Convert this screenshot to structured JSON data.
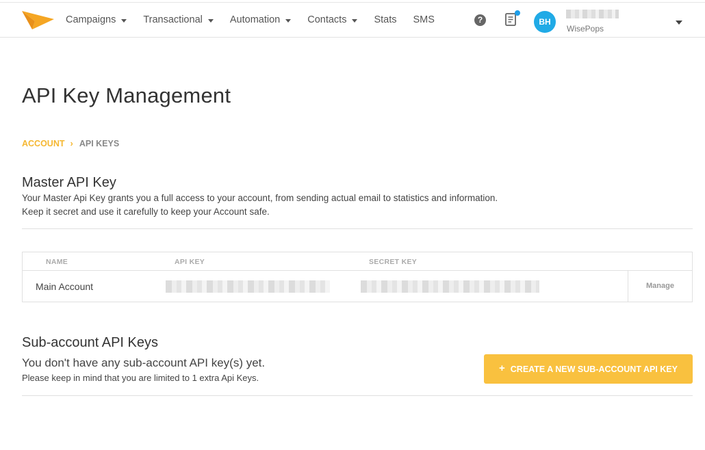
{
  "nav": {
    "items": [
      {
        "label": "Campaigns",
        "dropdown": true
      },
      {
        "label": "Transactional",
        "dropdown": true
      },
      {
        "label": "Automation",
        "dropdown": true
      },
      {
        "label": "Contacts",
        "dropdown": true
      },
      {
        "label": "Stats",
        "dropdown": false
      },
      {
        "label": "SMS",
        "dropdown": false
      }
    ],
    "help_glyph": "?",
    "user": {
      "initials": "BH",
      "company": "WisePops"
    }
  },
  "page": {
    "title": "API Key Management",
    "breadcrumb": {
      "account": "ACCOUNT",
      "separator": "›",
      "current": "API KEYS"
    }
  },
  "master": {
    "title": "Master API Key",
    "desc_line1": "Your Master Api Key grants you a full access to your account, from sending actual email to statistics and information.",
    "desc_line2": "Keep it secret and use it carefully to keep your Account safe.",
    "table": {
      "headers": {
        "name": "NAME",
        "api_key": "API KEY",
        "secret_key": "SECRET KEY"
      },
      "row": {
        "name": "Main Account",
        "manage": "Manage"
      }
    }
  },
  "sub": {
    "title": "Sub-account API Keys",
    "empty_text": "You don't have any sub-account API key(s) yet.",
    "limit_text": "Please keep in mind that you are limited to 1 extra Api Keys.",
    "create_button": "CREATE A NEW SUB-ACCOUNT API KEY",
    "create_plus": "+"
  },
  "colors": {
    "accent": "#f9c13f",
    "breadcrumb": "#f5b731",
    "avatar": "#20aae6",
    "logo": "#f5a623"
  }
}
